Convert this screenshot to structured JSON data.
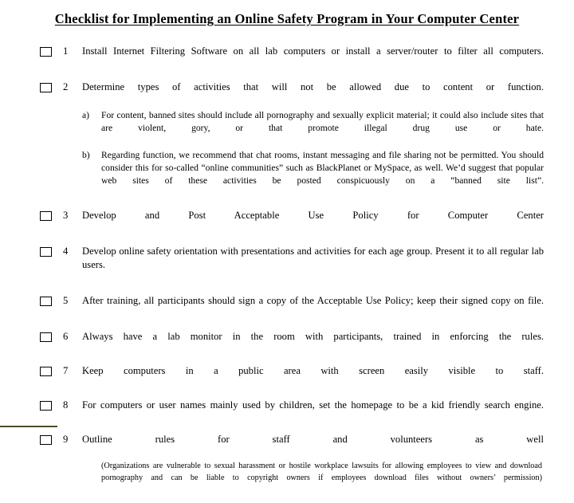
{
  "title": "Checklist for Implementing an Online Safety Program in Your Computer Center",
  "accent_color": "#4c4c28",
  "checklist": [
    {
      "number": "1",
      "text": "Install Internet Filtering Software on all lab computers or install a server/router to filter all computers."
    },
    {
      "number": "2",
      "text": "Determine types of activities that will not be allowed due to content or function.",
      "subitems": [
        {
          "marker": "a)",
          "text": "For content, banned sites should include all pornography and sexually explicit material; it could also include sites that are violent, gory, or that promote illegal drug use or hate."
        },
        {
          "marker": "b)",
          "text": "Regarding function, we recommend that chat rooms, instant messaging and file sharing not be permitted. You should consider this for so-called “online communities” such as BlackPlanet or MySpace, as well. We’d suggest that popular web sites of these activities be posted conspicuously on a “banned site list”."
        }
      ]
    },
    {
      "number": "3",
      "text": "Develop and Post Acceptable Use Policy for Computer Center"
    },
    {
      "number": "4",
      "text": "Develop online safety orientation with presentations and activities for each age group. Present it to all regular lab users."
    },
    {
      "number": "5",
      "text": "After training, all participants should sign a copy of the Acceptable Use Policy; keep their signed copy on file."
    },
    {
      "number": "6",
      "text": "Always have a lab monitor in the room with participants, trained in enforcing the rules."
    },
    {
      "number": "7",
      "text": "Keep computers in a public area with screen easily visible to staff."
    },
    {
      "number": "8",
      "text": "For computers or user names mainly used by children, set the homepage to be a kid friendly search engine."
    },
    {
      "number": "9",
      "text": "Outline rules for staff and volunteers as well",
      "note": "(Organizations are vulnerable to sexual harassment or hostile workplace lawsuits for allowing employees to view and download pornography and can be liable to copyright owners if employees download files without owners’ permission)"
    }
  ]
}
